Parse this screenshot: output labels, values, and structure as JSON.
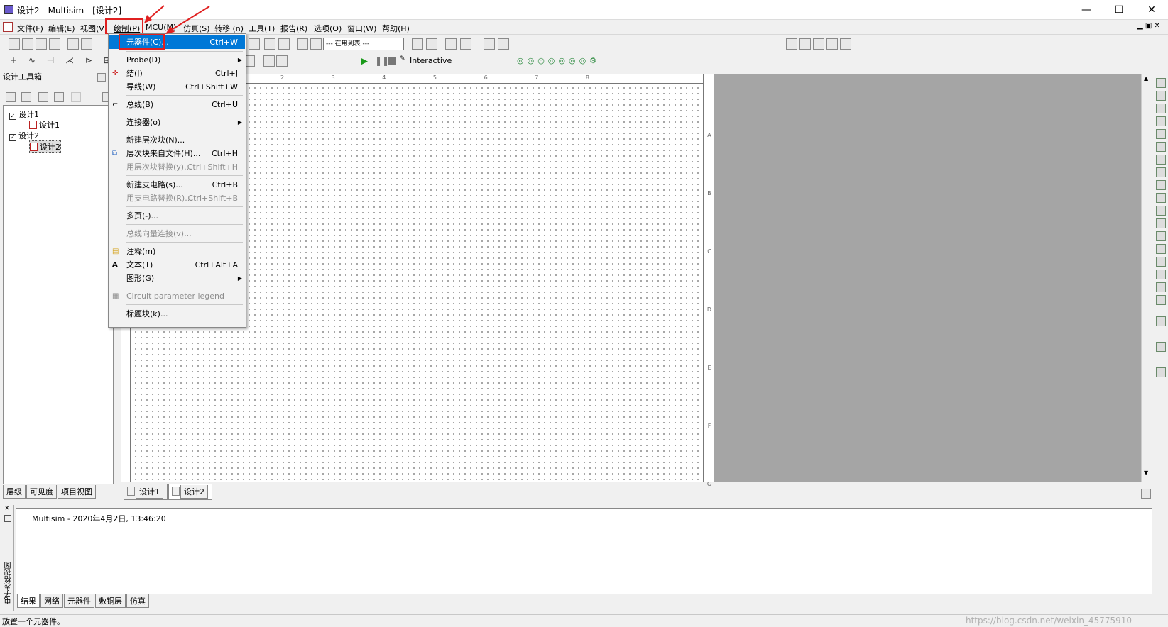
{
  "window": {
    "title": "设计2 - Multisim - [设计2]",
    "minimize": "—",
    "maximize": "☐",
    "close": "✕"
  },
  "menu": {
    "items": [
      "文件(F)",
      "编辑(E)",
      "视图(V)",
      "绘制(P)",
      "MCU(M)",
      "仿真(S)",
      "转移 (n)",
      "工具(T)",
      "报告(R)",
      "选项(O)",
      "窗口(W)",
      "帮助(H)"
    ]
  },
  "toolbar": {
    "list_combo": "--- 在用列表 ---",
    "interactive": "Interactive"
  },
  "left_panel": {
    "title": "设计工具箱",
    "tree": [
      "设计1",
      "设计1",
      "设计2",
      "设计2"
    ],
    "tabs": [
      "层级",
      "可见度",
      "项目视图"
    ]
  },
  "doc_tabs": [
    "设计1",
    "设计2"
  ],
  "ruler_top": [
    "2",
    "3",
    "4",
    "5",
    "6",
    "7",
    "8"
  ],
  "ruler_side": [
    "A",
    "B",
    "C",
    "D",
    "E",
    "F",
    "G"
  ],
  "dropdown": {
    "items": [
      {
        "label": "元器件(C)...",
        "shortcut": "Ctrl+W"
      },
      {
        "label": "Probe(D)",
        "shortcut": ""
      },
      {
        "label": "结(J)",
        "shortcut": "Ctrl+J"
      },
      {
        "label": "导线(W)",
        "shortcut": "Ctrl+Shift+W"
      },
      {
        "label": "总线(B)",
        "shortcut": "Ctrl+U"
      },
      {
        "label": "连接器(o)",
        "shortcut": ""
      },
      {
        "label": "新建层次块(N)...",
        "shortcut": ""
      },
      {
        "label": "层次块来自文件(H)...",
        "shortcut": "Ctrl+H"
      },
      {
        "label": "用层次块替换(y)...",
        "shortcut": "Ctrl+Shift+H"
      },
      {
        "label": "新建支电路(s)...",
        "shortcut": "Ctrl+B"
      },
      {
        "label": "用支电路替换(R)...",
        "shortcut": "Ctrl+Shift+B"
      },
      {
        "label": "多页(-)...",
        "shortcut": ""
      },
      {
        "label": "总线向量连接(v)...",
        "shortcut": ""
      },
      {
        "label": "注释(m)",
        "shortcut": ""
      },
      {
        "label": "文本(T)",
        "shortcut": "Ctrl+Alt+A"
      },
      {
        "label": "图形(G)",
        "shortcut": ""
      },
      {
        "label": "Circuit parameter legend",
        "shortcut": ""
      },
      {
        "label": "标题块(k)...",
        "shortcut": ""
      }
    ]
  },
  "output": {
    "message": "Multisim  -  2020年4月2日, 13:46:20",
    "side_label": "电子表格视图",
    "tabs": [
      "结果",
      "网络",
      "元器件",
      "敷铜层",
      "仿真"
    ]
  },
  "status": {
    "text": "放置一个元器件。",
    "watermark": "https://blog.csdn.net/weixin_45775910"
  }
}
